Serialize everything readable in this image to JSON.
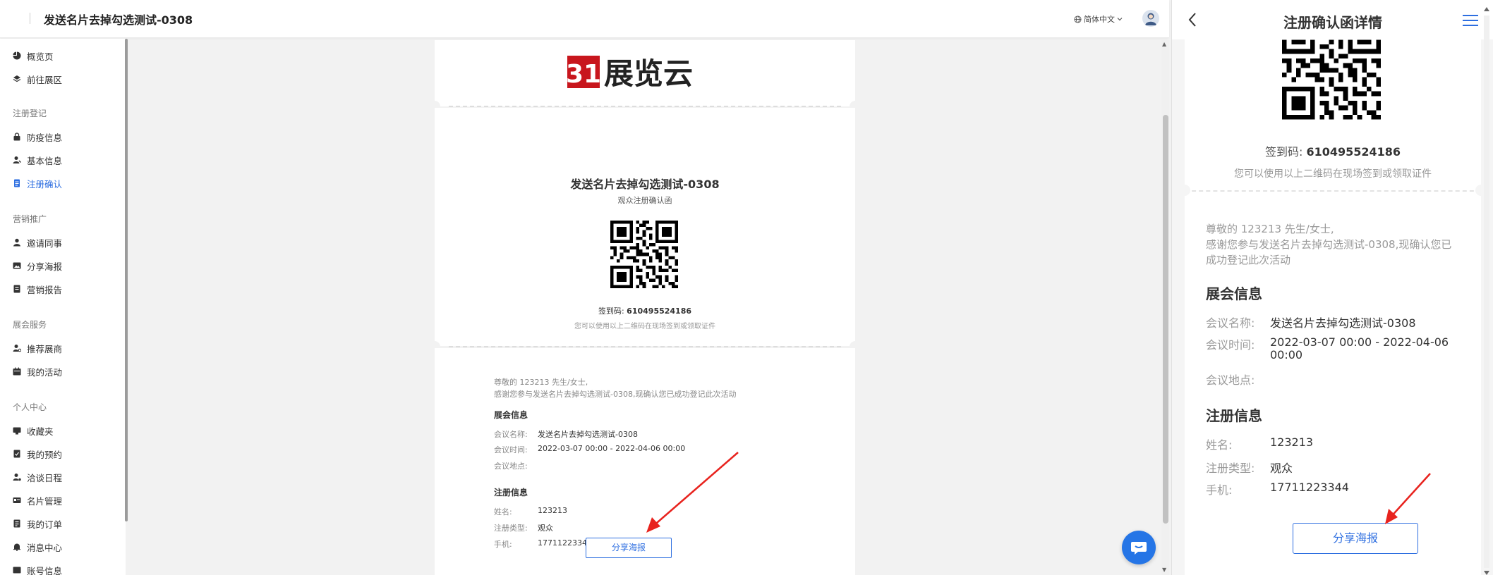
{
  "header": {
    "title": "发送名片去掉勾选测试-0308",
    "language": "简体中文"
  },
  "sidebar": {
    "items": [
      {
        "label": "概览页",
        "icon": "pie-chart-icon"
      },
      {
        "label": "前往展区",
        "icon": "layers-icon"
      }
    ],
    "groups": [
      {
        "title": "注册登记",
        "items": [
          {
            "label": "防疫信息",
            "icon": "lock-icon"
          },
          {
            "label": "基本信息",
            "icon": "user-edit-icon"
          },
          {
            "label": "注册确认",
            "icon": "document-icon",
            "active": true
          }
        ]
      },
      {
        "title": "营销推广",
        "items": [
          {
            "label": "邀请同事",
            "icon": "user-icon"
          },
          {
            "label": "分享海报",
            "icon": "image-icon"
          },
          {
            "label": "营销报告",
            "icon": "report-icon"
          }
        ]
      },
      {
        "title": "展会服务",
        "items": [
          {
            "label": "推荐展商",
            "icon": "user-star-icon"
          },
          {
            "label": "我的活动",
            "icon": "calendar-icon"
          }
        ]
      },
      {
        "title": "个人中心",
        "items": [
          {
            "label": "收藏夹",
            "icon": "folder-icon"
          },
          {
            "label": "我的预约",
            "icon": "booking-icon"
          },
          {
            "label": "洽谈日程",
            "icon": "user-schedule-icon"
          },
          {
            "label": "名片管理",
            "icon": "card-icon"
          },
          {
            "label": "我的订单",
            "icon": "order-icon"
          },
          {
            "label": "消息中心",
            "icon": "bell-icon"
          },
          {
            "label": "账号信息",
            "icon": "account-icon"
          }
        ]
      }
    ]
  },
  "ticket": {
    "logo_text": "展览云",
    "logo_number": "31",
    "event_title": "发送名片去掉勾选测试-0308",
    "subtitle": "观众注册确认函",
    "checkin_label": "签到码:",
    "checkin_code": "610495524186",
    "qr_hint": "您可以使用以上二维码在现场签到或领取证件",
    "greeting": "尊敬的 123213 先生/女士,",
    "thanks": "感谢您参与发送名片去掉勾选测试-0308,现确认您已成功登记此次活动",
    "event_section": "展会信息",
    "event_fields": [
      {
        "k": "会议名称:",
        "v": "发送名片去掉勾选测试-0308"
      },
      {
        "k": "会议时间:",
        "v": "2022-03-07 00:00 - 2022-04-06 00:00"
      },
      {
        "k": "会议地点:",
        "v": ""
      }
    ],
    "reg_section": "注册信息",
    "reg_fields": [
      {
        "k": "姓名:",
        "v": "123213"
      },
      {
        "k": "注册类型:",
        "v": "观众"
      },
      {
        "k": "手机:",
        "v": "17711223344"
      }
    ],
    "share_button": "分享海报"
  },
  "phone": {
    "title": "注册确认函详情",
    "checkin_label": "签到码:",
    "checkin_code": "610495524186",
    "qr_hint": "您可以使用以上二维码在现场签到或领取证件",
    "greeting": "尊敬的 123213 先生/女士,",
    "thanks_line1": "感谢您参与发送名片去掉勾选测试-0308,现确认您已",
    "thanks_line2": "成功登记此次活动",
    "event_section": "展会信息",
    "event_fields": [
      {
        "k": "会议名称:",
        "v": "发送名片去掉勾选测试-0308"
      },
      {
        "k": "会议时间:",
        "v": "2022-03-07 00:00 - 2022-04-06",
        "v2": "00:00"
      },
      {
        "k": "会议地点:",
        "v": ""
      }
    ],
    "reg_section": "注册信息",
    "reg_fields": [
      {
        "k": "姓名:",
        "v": "123213"
      },
      {
        "k": "注册类型:",
        "v": "观众"
      },
      {
        "k": "手机:",
        "v": "17711223344"
      }
    ],
    "share_button": "分享海报"
  },
  "colors": {
    "accent": "#2d6ee0",
    "arrow": "#e8231e",
    "logo_red": "#c8161d"
  }
}
